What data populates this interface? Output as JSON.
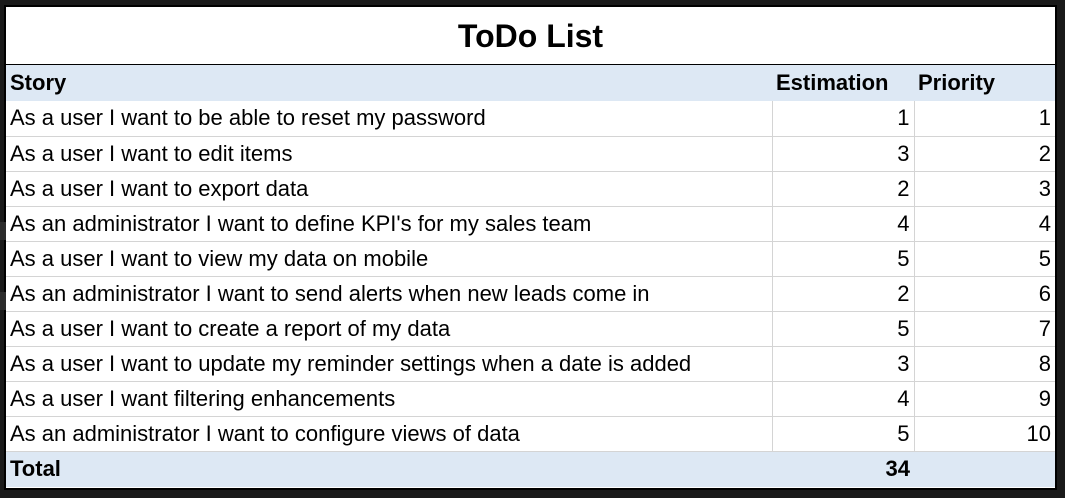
{
  "title": "ToDo List",
  "columns": {
    "story": "Story",
    "estimation": "Estimation",
    "priority": "Priority"
  },
  "rows": [
    {
      "story": "As a user I want to be able to reset my password",
      "estimation": "1",
      "priority": "1"
    },
    {
      "story": "As a user I want to edit items",
      "estimation": "3",
      "priority": "2"
    },
    {
      "story": "As a user I want to export data",
      "estimation": "2",
      "priority": "3"
    },
    {
      "story": "As an administrator I want to define KPI's for my sales team",
      "estimation": "4",
      "priority": "4"
    },
    {
      "story": "As a user I want to view my data on mobile",
      "estimation": "5",
      "priority": "5"
    },
    {
      "story": "As an administrator I want to send alerts when new leads come in",
      "estimation": "2",
      "priority": "6"
    },
    {
      "story": "As a user I want to create a report of my data",
      "estimation": "5",
      "priority": "7"
    },
    {
      "story": "As a user I want to update my reminder settings when a date is added",
      "estimation": "3",
      "priority": "8"
    },
    {
      "story": "As a user I want filtering enhancements",
      "estimation": "4",
      "priority": "9"
    },
    {
      "story": "As an administrator I want to configure views of data",
      "estimation": "5",
      "priority": "10"
    }
  ],
  "total": {
    "label": "Total",
    "estimation": "34"
  },
  "colors": {
    "header_background": "#dde8f4",
    "grid_line": "#d4d4d4",
    "frame_border": "#000000"
  }
}
